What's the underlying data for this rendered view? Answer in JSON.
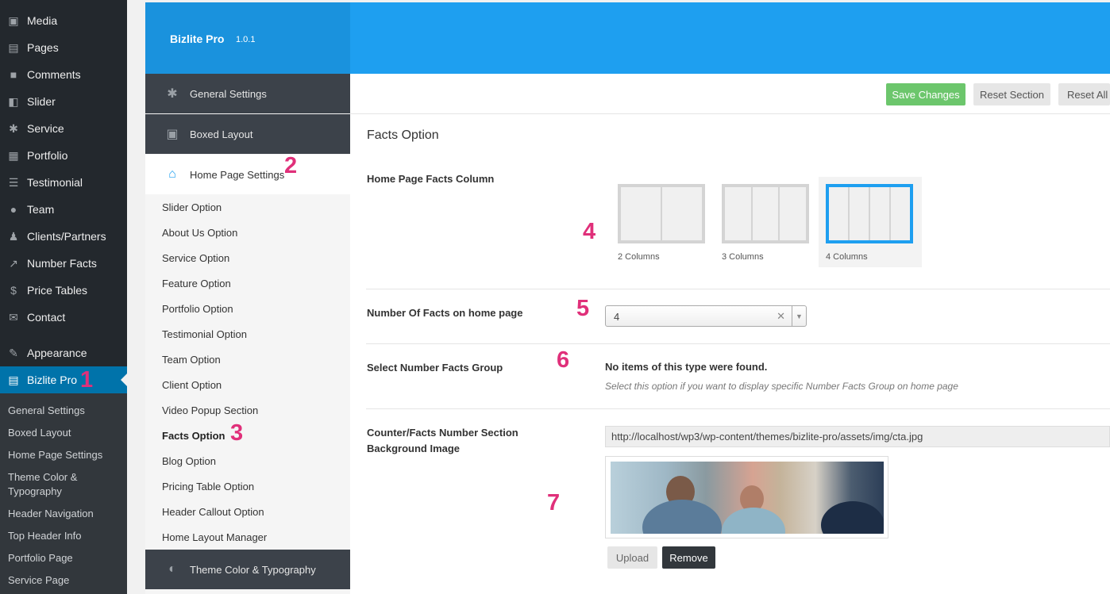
{
  "wp_menu": [
    {
      "label": "Media",
      "icon": "media-icon"
    },
    {
      "label": "Pages",
      "icon": "pages-icon"
    },
    {
      "label": "Comments",
      "icon": "comments-icon"
    },
    {
      "label": "Slider",
      "icon": "slider-icon"
    },
    {
      "label": "Service",
      "icon": "gear-icon"
    },
    {
      "label": "Portfolio",
      "icon": "portfolio-icon"
    },
    {
      "label": "Testimonial",
      "icon": "list-icon"
    },
    {
      "label": "Team",
      "icon": "team-icon"
    },
    {
      "label": "Clients/Partners",
      "icon": "user-icon"
    },
    {
      "label": "Number Facts",
      "icon": "chart-icon"
    },
    {
      "label": "Price Tables",
      "icon": "dollar-icon"
    },
    {
      "label": "Contact",
      "icon": "mail-icon"
    },
    {
      "label": "Appearance",
      "icon": "brush-icon"
    },
    {
      "label": "Bizlite Pro",
      "icon": "layout-icon"
    }
  ],
  "wp_submenu": [
    "General Settings",
    "Boxed Layout",
    "Home Page Settings",
    "Theme Color & Typography",
    "Header Navigation",
    "Top Header Info",
    "Portfolio Page",
    "Service Page"
  ],
  "brand": {
    "name": "Bizlite Pro",
    "version": "1.0.1"
  },
  "options_nav": {
    "general": "General Settings",
    "boxed": "Boxed Layout",
    "home": "Home Page Settings",
    "theme": "Theme Color & Typography",
    "sub_items": [
      "Slider Option",
      "About Us Option",
      "Service Option",
      "Feature Option",
      "Portfolio Option",
      "Testimonial Option",
      "Team Option",
      "Client Option",
      "Video Popup Section",
      "Facts Option",
      "Blog Option",
      "Pricing Table Option",
      "Header Callout Option",
      "Home Layout Manager"
    ]
  },
  "toolbar": {
    "save": "Save Changes",
    "reset_section": "Reset Section",
    "reset_all": "Reset All"
  },
  "section": {
    "title": "Facts Option",
    "columns_label": "Home Page Facts Column",
    "columns_options": [
      "2 Columns",
      "3 Columns",
      "4 Columns"
    ],
    "number_label": "Number Of Facts on home page",
    "number_value": "4",
    "group_label": "Select Number Facts Group",
    "group_empty": "No items of this type were found.",
    "group_desc": "Select this option if you want to display specific Number Facts Group on home page",
    "bg_label": "Counter/Facts Number Section Background Image",
    "bg_url": "http://localhost/wp3/wp-content/themes/bizlite-pro/assets/img/cta.jpg",
    "upload": "Upload",
    "remove": "Remove"
  },
  "markers": [
    "1",
    "2",
    "3",
    "4",
    "5",
    "6",
    "7"
  ],
  "colors": {
    "accent": "#1e9ff0",
    "save": "#6cc66c",
    "marker": "#e0307a"
  }
}
